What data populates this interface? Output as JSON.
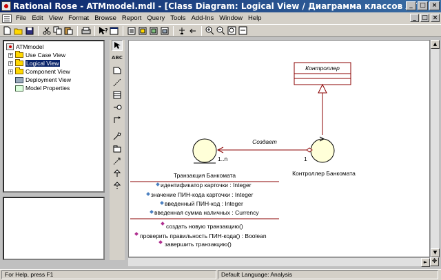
{
  "window": {
    "title": "Rational Rose - ATMmodel.mdl - [Class Diagram: Logical View / Диаграмма классов ATM]",
    "minimize": "_",
    "maximize": "□",
    "close": "×"
  },
  "menubar": {
    "items": [
      "File",
      "Edit",
      "View",
      "Format",
      "Browse",
      "Report",
      "Query",
      "Tools",
      "Add-Ins",
      "Window",
      "Help"
    ]
  },
  "toolbar": {
    "icons": [
      "new-icon",
      "open-icon",
      "save-icon",
      "cut-icon",
      "copy-icon",
      "paste-icon",
      "print-icon",
      "context-help-icon",
      "view-doc-icon",
      "browse-class-icon",
      "browse-interaction-icon",
      "browse-component-icon",
      "browse-deployment-icon",
      "browse-parent-icon",
      "browse-previous-icon",
      "zoom-in-icon",
      "zoom-out-icon",
      "fit-window-icon",
      "undo-fit-icon"
    ]
  },
  "browser": {
    "root": "ATMmodel",
    "items": [
      {
        "label": "Use Case View",
        "expander": "+",
        "icon": "folder-icon"
      },
      {
        "label": "Logical View",
        "expander": "+",
        "icon": "folder-icon",
        "selected": true
      },
      {
        "label": "Component View",
        "expander": "+",
        "icon": "folder-icon"
      },
      {
        "label": "Deployment View",
        "expander": "",
        "icon": "deployment-icon"
      },
      {
        "label": "Model Properties",
        "expander": "",
        "icon": "properties-icon"
      }
    ]
  },
  "palette": {
    "icons": [
      "selection-tool-icon",
      "text-tool-icon",
      "note-tool-icon",
      "anchor-tool-icon",
      "class-tool-icon",
      "interface-tool-icon",
      "association-tool-icon",
      "aggregation-tool-icon",
      "package-tool-icon",
      "dependency-tool-icon",
      "generalization-tool-icon",
      "realize-tool-icon"
    ],
    "text_label": "ABC"
  },
  "diagram": {
    "controller_class": {
      "name": "Контроллер"
    },
    "controller_entity": {
      "name": "Контроллер Банкомата"
    },
    "transaction_entity": {
      "name": "Транзакция Банкомата",
      "attributes": [
        "идентификатор карточки : Integer",
        "значение ПИН-кода карточки : Integer",
        "введенный ПИН-код : Integer",
        "введенная сумма наличных : Currency"
      ],
      "operations": [
        "создать новую транзакцию()",
        "проверить правильность ПИН-кода() : Boolean",
        "завершить транзакцию()"
      ]
    },
    "association": {
      "label": "Создает",
      "multiplicity_left": "1..n",
      "multiplicity_right": "1"
    },
    "colors": {
      "line": "#8b0000",
      "attr_icon": "#4a7fc0",
      "op_icon": "#b03090"
    }
  },
  "status": {
    "help": "For Help, press F1",
    "language": "Default Language: Analysis"
  }
}
